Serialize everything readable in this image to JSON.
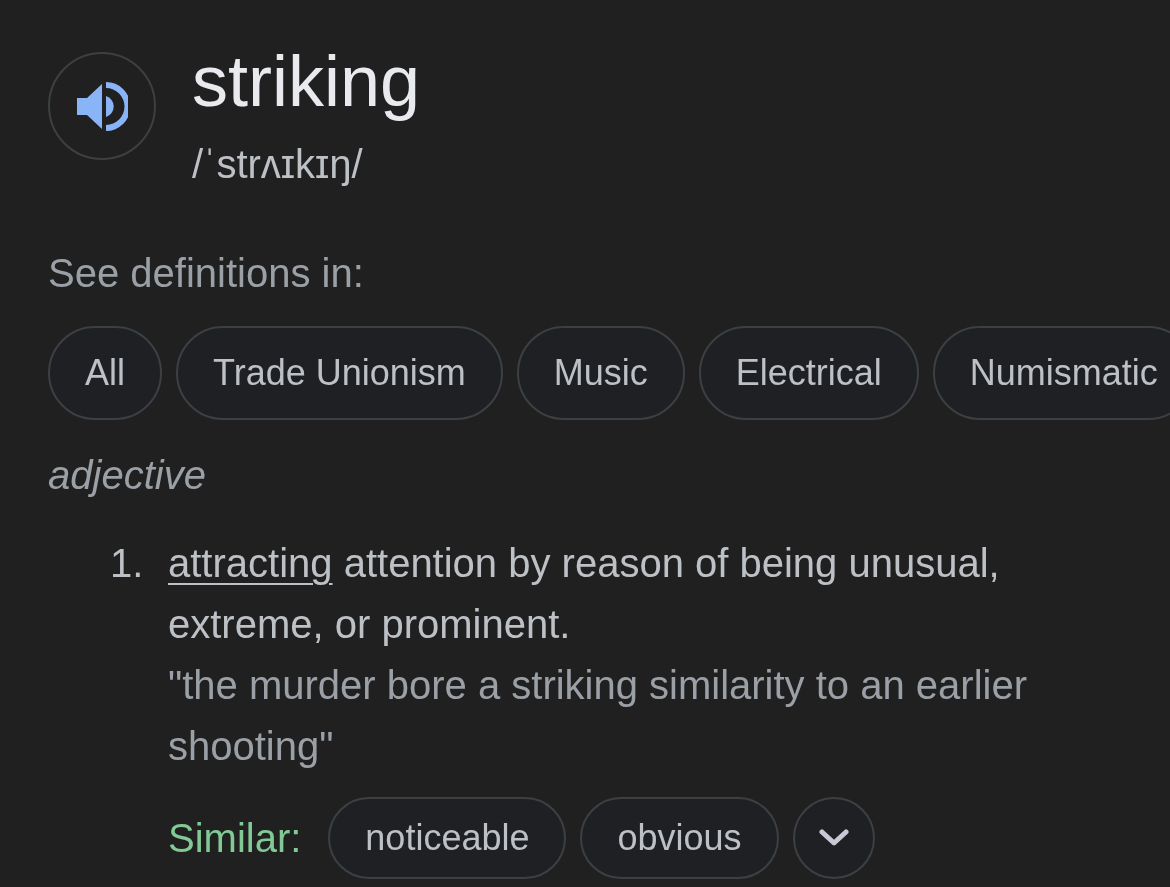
{
  "entry": {
    "word": "striking",
    "phonetic": "/ˈstrʌɪkɪŋ/"
  },
  "domains": {
    "label": "See definitions in:",
    "chips": [
      {
        "label": "All"
      },
      {
        "label": "Trade Unionism"
      },
      {
        "label": "Music"
      },
      {
        "label": "Electrical"
      },
      {
        "label": "Numismatic"
      }
    ]
  },
  "senses": [
    {
      "part_of_speech": "adjective",
      "definitions": [
        {
          "number": "1.",
          "link": "attracting",
          "text": "attention by reason of being unusual, extreme, or prominent.",
          "example": "\"the murder bore a striking similarity to an earlier shooting\"",
          "similar": {
            "label": "Similar:",
            "words": [
              "noticeable",
              "obvious"
            ]
          }
        }
      ]
    }
  ]
}
